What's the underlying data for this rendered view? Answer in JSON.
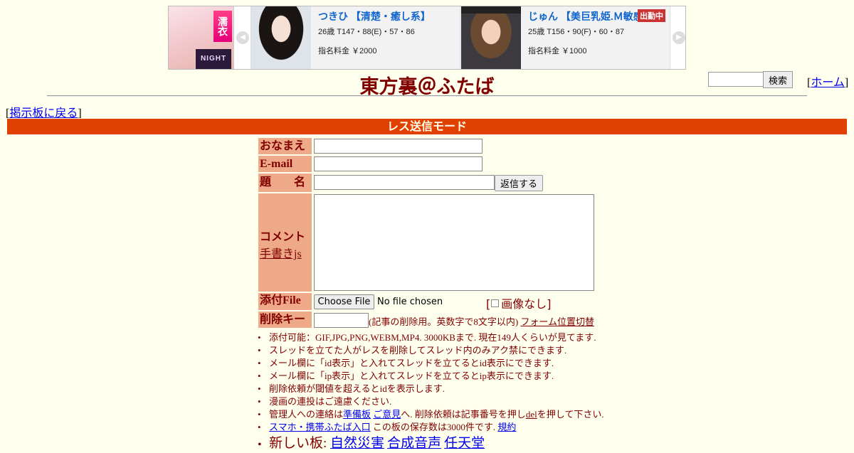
{
  "ad": {
    "left_ribbon": "濡衣",
    "left_logo": "NIGHT",
    "prev_arrow": "◀",
    "next_arrow": "▶",
    "cards": [
      {
        "name": "つきひ 【清楚・癒し系】",
        "stats": "26歳 T147・88(E)・57・86",
        "price": "指名料金 ￥2000",
        "badge": ""
      },
      {
        "name": "じゅん 【美巨乳姫.Ｍ敏感体",
        "stats": "25歳 T156・90(F)・60・87",
        "price": "指名料金 ￥1000",
        "badge": "出勤中"
      }
    ]
  },
  "header": {
    "title": "東方裏＠ふたば",
    "search_button": "検索",
    "search_value": "",
    "home_link": "ホーム"
  },
  "back_link": "掲示板に戻る",
  "mode_label": "レス送信モード",
  "form": {
    "name_label": "おなまえ",
    "email_label": "E-mail",
    "subject_label": "題　　名",
    "submit_button": "返信する",
    "comment_label": "コメント",
    "handwrite_link": "手書きjs",
    "file_label": "添付File",
    "file_button": "Choose File",
    "file_status": "No file chosen",
    "no_image_label": "画像なし",
    "delkey_label": "削除キー",
    "delkey_note": "(記事の削除用。英数字で8文字以内)",
    "toggle_link": "フォーム位置切替"
  },
  "notes": {
    "n1": "添付可能：GIF,JPG,PNG,WEBM,MP4. 3000KBまで. 現在149人くらいが見てます.",
    "n2": "スレッドを立てた人がレスを削除してスレッド内のみアク禁にできます.",
    "n3": "メール欄に「id表示」と入れてスレッドを立てるとid表示にできます.",
    "n4": "メール欄に「ip表示」と入れてスレッドを立てるとip表示にできます.",
    "n5": "削除依頼が閾値を超えるとidを表示します.",
    "n6": "漫画の連投はご遠慮ください.",
    "n7_pre": "管理人への連絡は",
    "n7_link1": "準備板",
    "n7_link2": "ご意見",
    "n7_mid": "へ. 削除依頼は記事番号を押し",
    "n7_del": "del",
    "n7_post": "を押して下さい.",
    "n8_link": "スマホ・携帯ふたば入口",
    "n8_text": " この板の保存数は3000件です.",
    "n8_rule": "規約",
    "n9_label": "新しい板: ",
    "n9_boards": [
      "自然災害",
      "合成音声",
      "任天堂"
    ]
  }
}
